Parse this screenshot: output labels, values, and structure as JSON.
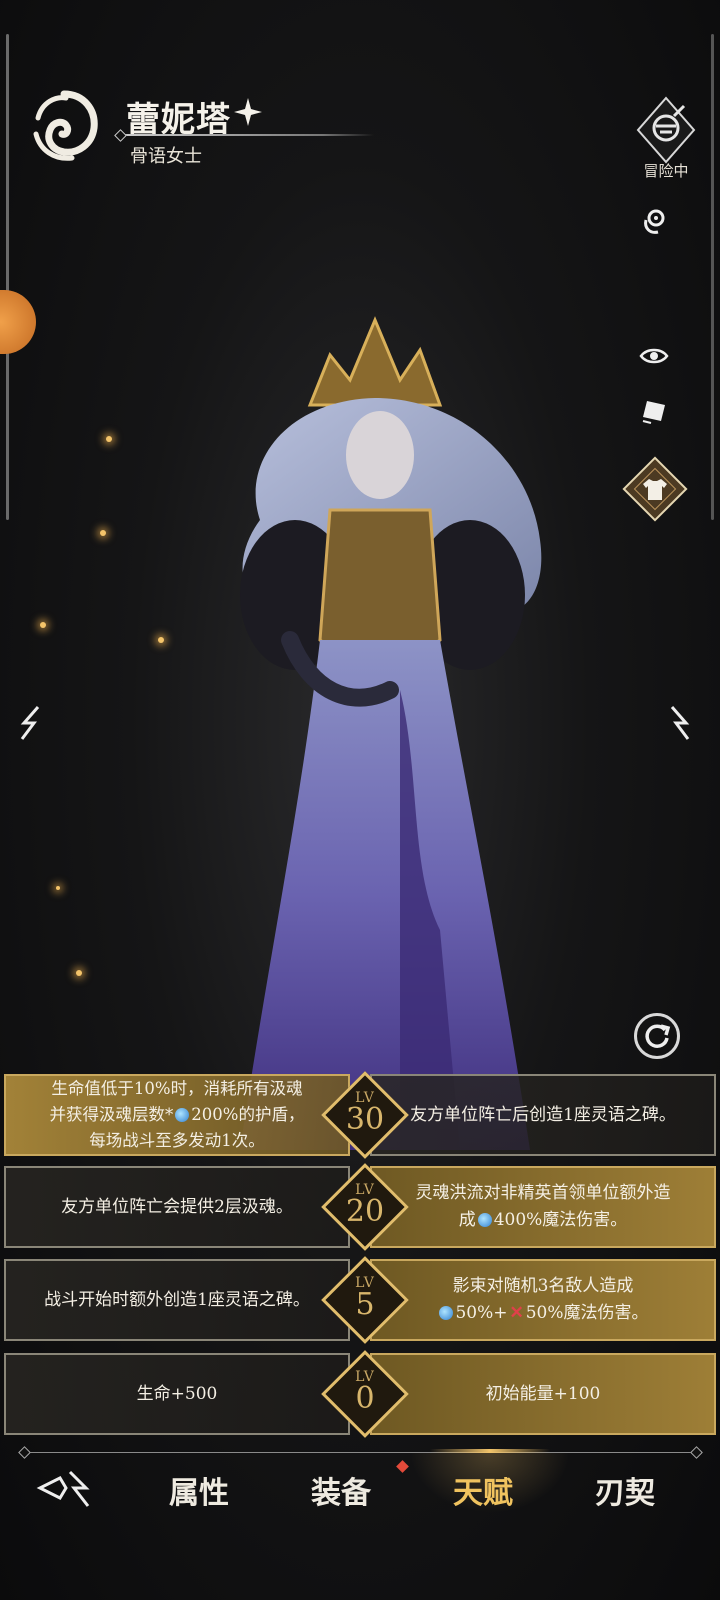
{
  "hero": {
    "name": "蕾妮塔",
    "title": "骨语女士"
  },
  "status": {
    "label": "冒险中"
  },
  "talents": [
    {
      "level_prefix": "LV",
      "level": "30",
      "left": {
        "line1": "生命值低于10%时，消耗所有汲魂",
        "line2_pre": "并获得汲魂层数*",
        "line2_post": "200%的护盾，",
        "line3": "每场战斗至多发动1次。"
      },
      "right": {
        "text": "友方单位阵亡后创造1座灵语之碑。"
      }
    },
    {
      "level_prefix": "LV",
      "level": "20",
      "left": {
        "text": "友方单位阵亡会提供2层汲魂。"
      },
      "right": {
        "line1": "灵魂洪流对非精英首领单位额外造",
        "line2_pre": "成",
        "line2_post": "400%魔法伤害。"
      }
    },
    {
      "level_prefix": "LV",
      "level": "5",
      "left": {
        "text": "战斗开始时额外创造1座灵语之碑。"
      },
      "right": {
        "line1": "影束对随机3名敌人造成",
        "line2_a": "50%+",
        "line2_b": "50%魔法伤害。"
      }
    },
    {
      "level_prefix": "LV",
      "level": "0",
      "left": {
        "text": "生命+500"
      },
      "right": {
        "text": "初始能量+100"
      }
    }
  ],
  "nav": {
    "tabs": [
      "属性",
      "装备",
      "天赋",
      "刃契"
    ],
    "active": "天赋"
  },
  "colors": {
    "gold": "#c9a85e",
    "active_tab": "#f0c35f",
    "notify": "#e34a3a"
  }
}
